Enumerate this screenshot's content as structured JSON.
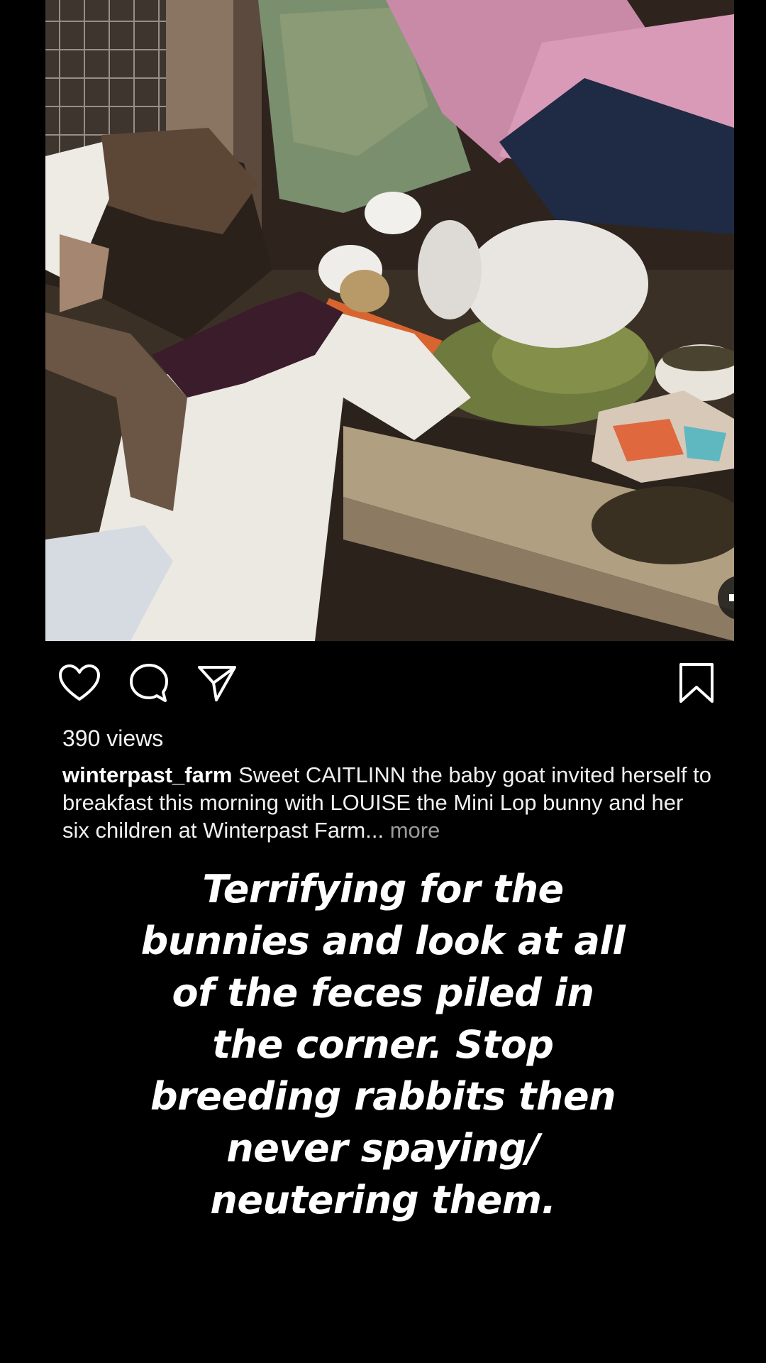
{
  "post": {
    "media_alt": "video",
    "views_text": "390 views",
    "username": "winterpast_farm",
    "caption_text": "Sweet CAITLINN the baby goat invited herself to breakfast this morning with LOUISE the Mini Lop bunny and her six children at Winterpast Farm...",
    "more_label": "more"
  },
  "icons": {
    "like": "heart-icon",
    "comment": "comment-bubble-icon",
    "share": "paper-plane-icon",
    "save": "bookmark-icon",
    "sound": "speaker-icon"
  },
  "overlay": {
    "line1": "Terrifying for the",
    "line2": "bunnies and look at all",
    "line3": "of the feces piled in",
    "line4": "the corner. Stop",
    "line5": "breeding rabbits then",
    "line6": "never spaying/",
    "line7": "neutering them."
  },
  "colors": {
    "background": "#000000",
    "text": "#ffffff",
    "muted": "#9a9a9a"
  }
}
